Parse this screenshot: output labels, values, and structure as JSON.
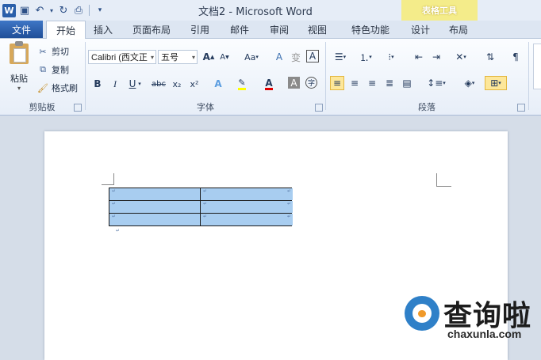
{
  "window": {
    "title": "文档2 - Microsoft Word",
    "context_group": "表格工具",
    "app_icon": "W"
  },
  "quick_access": [
    {
      "name": "save-icon",
      "glyph": "💾"
    },
    {
      "name": "undo-icon",
      "glyph": "↶"
    },
    {
      "name": "redo-icon",
      "glyph": "↻"
    },
    {
      "name": "print-preview-icon",
      "glyph": "🖶"
    },
    {
      "name": "customize-icon",
      "glyph": "⌄"
    }
  ],
  "tabs": {
    "file": "文件",
    "home": "开始",
    "insert": "插入",
    "layout": "页面布局",
    "references": "引用",
    "mailings": "邮件",
    "review": "审阅",
    "view": "视图",
    "special": "特色功能",
    "design": "设计",
    "table_layout": "布局"
  },
  "clipboard": {
    "paste": "粘贴",
    "cut": "剪切",
    "copy": "复制",
    "format_painter": "格式刷",
    "group_label": "剪贴板"
  },
  "font": {
    "name": "Calibri (西文正",
    "size": "五号",
    "group_label": "字体",
    "bold": "B",
    "italic": "I",
    "underline": "U",
    "strikethrough": "abc",
    "subscript": "x₂",
    "superscript": "x²",
    "case_label": "Aa",
    "grow": "A",
    "shrink": "A",
    "clear_format": "A",
    "char_border": "A",
    "char_shading": "A",
    "text_effect": "A",
    "font_color": "A",
    "circle_char": "字"
  },
  "paragraph": {
    "group_label": "段落"
  },
  "colors": {
    "accent": "#2b579a",
    "context_yellow": "#f4ec8a",
    "selection": "#a8cdf0",
    "highlight_yellow": "#ffff00",
    "font_red": "#e00000"
  },
  "watermark": {
    "text": "查询啦",
    "url": "chaxunla.com"
  }
}
